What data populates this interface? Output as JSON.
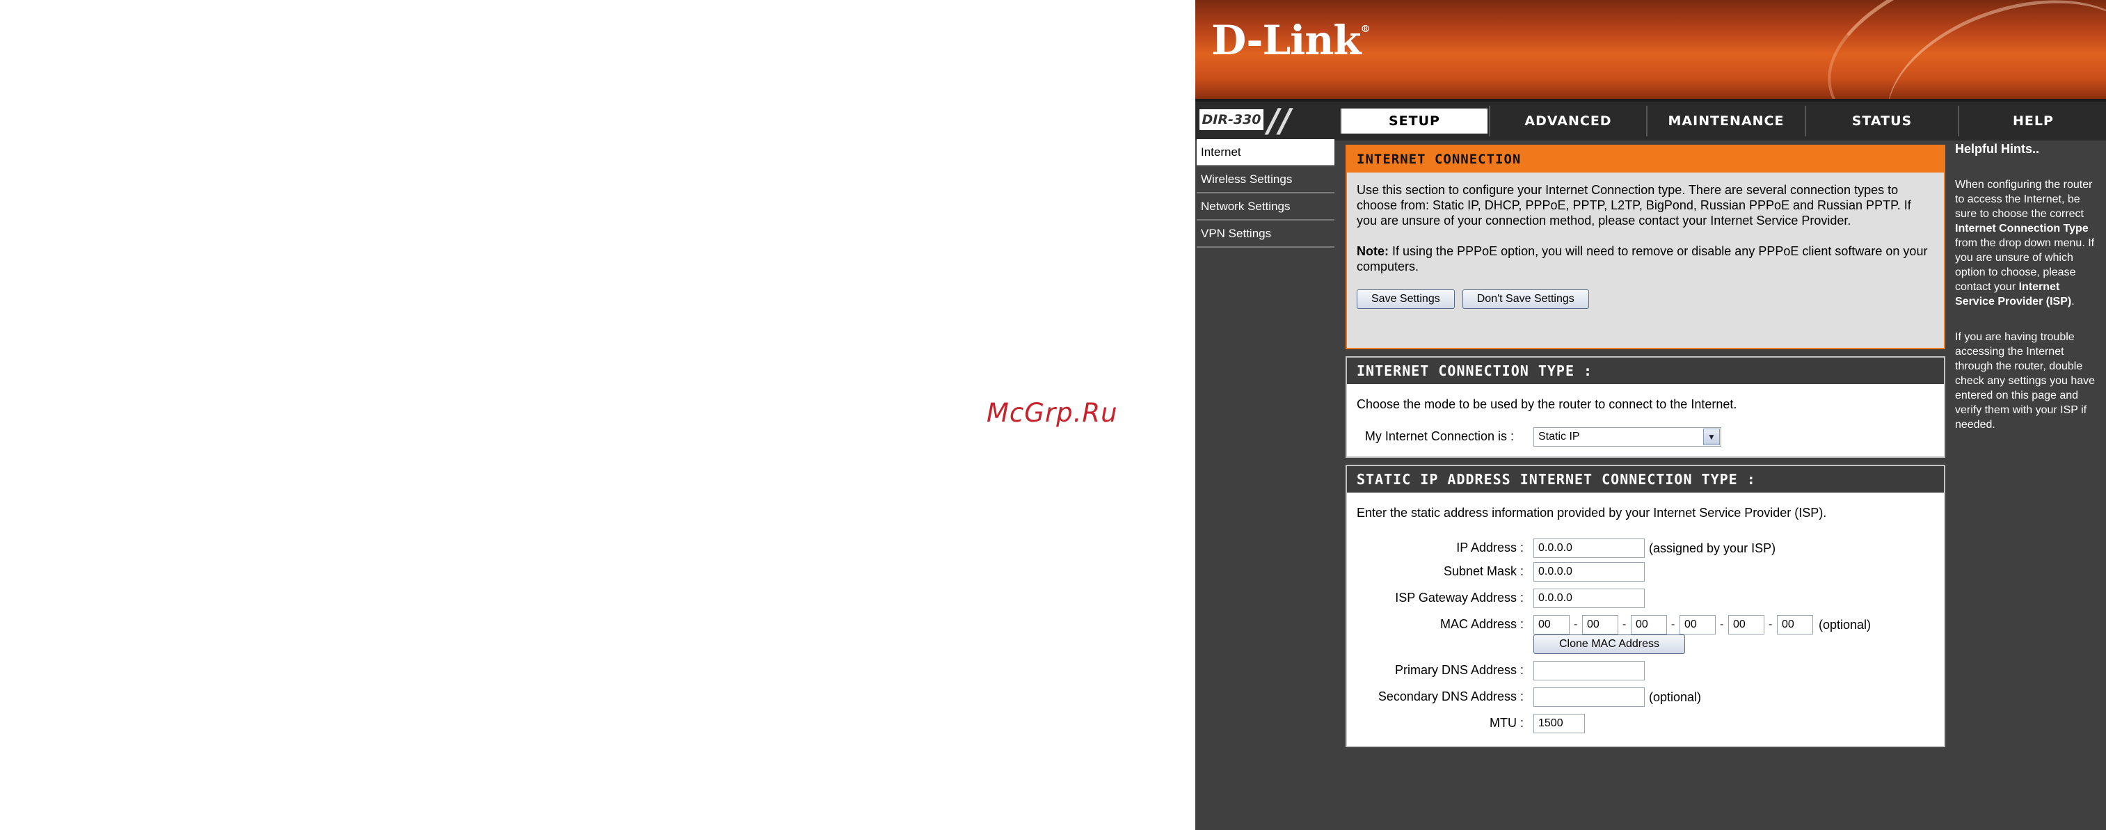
{
  "watermark": "McGrp.Ru",
  "brand": {
    "logo": "D-Link",
    "trademark": "®",
    "model": "DIR-330",
    "accent": "#f07a1b"
  },
  "nav": {
    "tabs": [
      "SETUP",
      "ADVANCED",
      "MAINTENANCE",
      "STATUS",
      "HELP"
    ],
    "active": "SETUP"
  },
  "sidebar": {
    "items": [
      "Internet",
      "Wireless Settings",
      "Network Settings",
      "VPN Settings"
    ],
    "active": "Internet"
  },
  "internet_connection": {
    "title": "INTERNET CONNECTION",
    "intro": "Use this section to configure your Internet Connection type. There are several connection types to choose from: Static IP, DHCP, PPPoE, PPTP, L2TP, BigPond, Russian PPPoE and Russian PPTP. If you are unsure of your connection method, please contact your Internet Service Provider.",
    "note_label": "Note:",
    "note_text": "If using the PPPoE option, you will need to remove or disable any PPPoE client software on your computers.",
    "save_label": "Save Settings",
    "dont_save_label": "Don't Save Settings"
  },
  "connection_type": {
    "title": "INTERNET CONNECTION TYPE :",
    "desc": "Choose the mode to be used by the router to connect to the Internet.",
    "label": "My Internet Connection is :",
    "selected": "Static IP"
  },
  "static_ip": {
    "title": "STATIC IP ADDRESS INTERNET CONNECTION TYPE :",
    "desc": "Enter the static address information provided by your Internet Service Provider (ISP).",
    "ip_label": "IP Address :",
    "ip_value": "0.0.0.0",
    "ip_note": "(assigned by your ISP)",
    "mask_label": "Subnet Mask :",
    "mask_value": "0.0.0.0",
    "gateway_label": "ISP Gateway Address :",
    "gateway_value": "0.0.0.0",
    "mac_label": "MAC Address :",
    "mac_values": [
      "00",
      "00",
      "00",
      "00",
      "00",
      "00"
    ],
    "mac_sep": "-",
    "mac_note": "(optional)",
    "clone_label": "Clone MAC Address",
    "dns1_label": "Primary DNS Address :",
    "dns1_value": "",
    "dns2_label": "Secondary DNS Address :",
    "dns2_value": "",
    "dns2_note": "(optional)",
    "mtu_label": "MTU :",
    "mtu_value": "1500"
  },
  "help": {
    "title": "Helpful Hints..",
    "p1_a": "When configuring the router to access the Internet, be sure to choose the correct ",
    "p1_b": "Internet Connection Type",
    "p1_c": " from the drop down menu. If you are unsure of which option to choose, please contact your ",
    "p1_d": "Internet Service Provider (ISP)",
    "p1_e": ".",
    "p2": "If you are having trouble accessing the Internet through the router, double check any settings you have entered on this page and verify them with your ISP if needed."
  }
}
